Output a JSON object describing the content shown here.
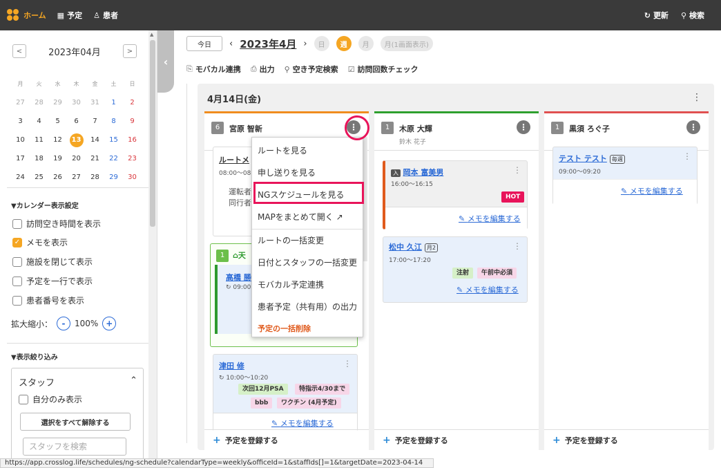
{
  "topbar": {
    "nav": [
      {
        "label": "ホーム",
        "icon": "home-logo"
      },
      {
        "label": "予定",
        "icon": "calendar-icon"
      },
      {
        "label": "患者",
        "icon": "user-icon"
      }
    ],
    "refresh": "更新",
    "search": "検索"
  },
  "sidebar": {
    "month": "2023年04月",
    "weekdays": [
      "月",
      "火",
      "水",
      "木",
      "金",
      "土",
      "日"
    ],
    "weeks": [
      [
        "27",
        "28",
        "29",
        "30",
        "31",
        "1",
        "2"
      ],
      [
        "3",
        "4",
        "5",
        "6",
        "7",
        "8",
        "9"
      ],
      [
        "10",
        "11",
        "12",
        "13",
        "14",
        "15",
        "16"
      ],
      [
        "17",
        "18",
        "19",
        "20",
        "21",
        "22",
        "23"
      ],
      [
        "24",
        "25",
        "26",
        "27",
        "28",
        "29",
        "30"
      ]
    ],
    "today": "13",
    "settings_title": "▼カレンダー表示設定",
    "options": [
      {
        "label": "訪問空き時間を表示",
        "checked": false
      },
      {
        "label": "メモを表示",
        "checked": true
      },
      {
        "label": "施設を閉じて表示",
        "checked": false
      },
      {
        "label": "予定を一行で表示",
        "checked": false
      },
      {
        "label": "患者番号を表示",
        "checked": false
      }
    ],
    "zoom_label": "拡大縮小：",
    "zoom_value": "100%",
    "filter_title": "▼表示絞り込み",
    "staff_label": "スタッフ",
    "self_only": "自分のみ表示",
    "clear_all": "選択をすべて解除する",
    "staff_search_placeholder": "スタッフを検索"
  },
  "toolbar": {
    "today": "今日",
    "current_month": "2023年4月",
    "views": [
      {
        "label": "日",
        "active": false
      },
      {
        "label": "週",
        "active": true
      },
      {
        "label": "月",
        "active": false
      },
      {
        "label": "月(1画面表示)",
        "active": false
      }
    ],
    "actions": [
      {
        "label": "モバカル連携",
        "icon": "sync-doc-icon"
      },
      {
        "label": "出力",
        "icon": "print-icon"
      },
      {
        "label": "空き予定検索",
        "icon": "search-icon"
      },
      {
        "label": "訪問回数チェック",
        "icon": "calendar-check-icon"
      }
    ]
  },
  "day": {
    "title": "4月14日(金)",
    "columns": [
      {
        "num": "6",
        "name": "宮原 智新",
        "sub": "",
        "color": "#f08c1e",
        "add": "予定を登録する"
      },
      {
        "num": "1",
        "name": "木原 大輝",
        "sub": "鈴木 花子",
        "color": "#2ea02e",
        "add": "予定を登録する"
      },
      {
        "num": "1",
        "name": "黒須 ろぐ子",
        "sub": "",
        "color": "#e05050",
        "add": "予定を登録する"
      }
    ],
    "col1_cards": {
      "route_title": "ルートメ",
      "route_time": "08:00〜08",
      "route_l1": "運転者",
      "route_l2": "同行者",
      "facility_num": "1",
      "facility_name": "天",
      "facility_person": "高橋 勝",
      "facility_time": "09:00",
      "tsuda_name": "津田 修",
      "tsuda_time": "10:00〜10:20",
      "tsuda_tags": [
        "次回12月PSA",
        "特指示4/30まで",
        "bbb",
        "ワクチン (4月予定)"
      ],
      "memo": "メモを編集する"
    },
    "col2_cards": {
      "c1_badge": "入",
      "c1_name": "岡本 富美男",
      "c1_time": "16:00〜16:15",
      "c1_tag": "HOT",
      "c2_name": "松中 久江",
      "c2_badge": "月2",
      "c2_time": "17:00〜17:20",
      "c2_tags": [
        "注射",
        "午前中必須"
      ],
      "memo": "メモを編集する"
    },
    "col3_cards": {
      "c1_name": "テスト テスト",
      "c1_badge": "毎週",
      "c1_time": "09:00〜09:20",
      "memo": "メモを編集する"
    }
  },
  "menu": {
    "items": [
      "ルートを見る",
      "申し送りを見る",
      "NGスケジュールを見る",
      "MAPをまとめて開く",
      "ルートの一括変更",
      "日付とスタッフの一括変更",
      "モバカル予定連携",
      "患者予定（共有用）の出力",
      "予定の一括削除"
    ]
  },
  "status_url": "https://app.crosslog.life/schedules/ng-schedule?calendarType=weekly&officeId=1&staffIds[]=1&targetDate=2023-04-14"
}
